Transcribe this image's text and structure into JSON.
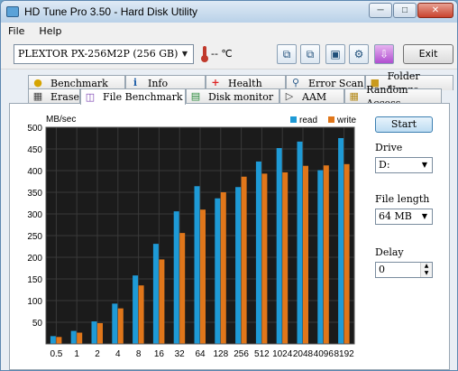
{
  "window": {
    "title": "HD Tune Pro 3.50 - Hard Disk Utility",
    "minimize_icon": "minimize-icon",
    "maximize_icon": "maximize-icon",
    "close_icon": "close-icon"
  },
  "menu": {
    "file": "File",
    "help": "Help"
  },
  "toolbar": {
    "drive": "PLEXTOR  PX-256M2P (256 GB)",
    "temperature": "-- ℃",
    "exit_label": "Exit"
  },
  "tabs_top": [
    {
      "label": "Benchmark",
      "icon": "benchmark-icon"
    },
    {
      "label": "Info",
      "icon": "info-icon"
    },
    {
      "label": "Health",
      "icon": "health-icon"
    },
    {
      "label": "Error Scan",
      "icon": "error-scan-icon"
    },
    {
      "label": "Folder Usage",
      "icon": "folder-icon"
    }
  ],
  "tabs_bottom": [
    {
      "label": "Erase",
      "icon": "trash-icon"
    },
    {
      "label": "File Benchmark",
      "icon": "file-benchmark-icon"
    },
    {
      "label": "Disk monitor",
      "icon": "disk-monitor-icon"
    },
    {
      "label": "AAM",
      "icon": "speaker-icon"
    },
    {
      "label": "Random Access",
      "icon": "random-access-icon"
    }
  ],
  "side": {
    "start_label": "Start",
    "drive_label": "Drive",
    "drive_value": "D:",
    "file_length_label": "File length",
    "file_length_value": "64 MB",
    "delay_label": "Delay",
    "delay_value": "0"
  },
  "colors": {
    "read": "#1e9ad6",
    "write": "#e0761a",
    "plot_bg": "#1b1b1b",
    "grid": "#3a3a3a"
  },
  "chart_data": {
    "type": "bar",
    "ylabel": "MB/sec",
    "ylim": [
      0,
      500
    ],
    "yticks": [
      50,
      100,
      150,
      200,
      250,
      300,
      350,
      400,
      450,
      500
    ],
    "categories": [
      "0.5",
      "1",
      "2",
      "4",
      "8",
      "16",
      "32",
      "64",
      "128",
      "256",
      "512",
      "1024",
      "2048",
      "4096",
      "8192"
    ],
    "series": [
      {
        "name": "read",
        "values": [
          18,
          30,
          52,
          93,
          158,
          231,
          306,
          364,
          336,
          362,
          421,
          452,
          467,
          401,
          475
        ]
      },
      {
        "name": "write",
        "values": [
          16,
          26,
          48,
          82,
          135,
          195,
          256,
          310,
          350,
          386,
          393,
          396,
          411,
          412,
          415
        ]
      }
    ],
    "legend": "top-right",
    "grid": true
  }
}
